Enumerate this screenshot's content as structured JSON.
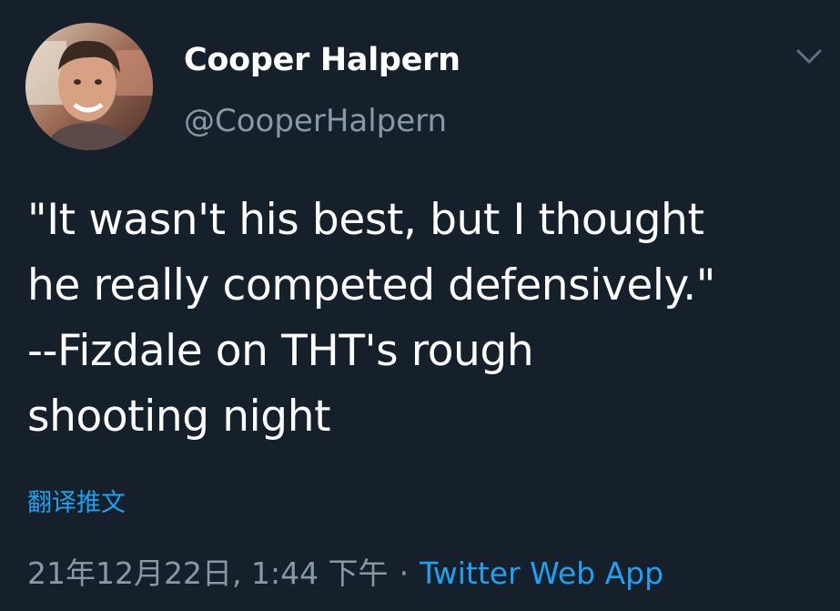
{
  "user": {
    "name": "Cooper Halpern",
    "handle": "@CooperHalpern"
  },
  "tweet": {
    "text": "\"It wasn't his best, but I thought\nhe really competed defensively.\"\n--Fizdale on THT's rough\nshooting night",
    "translate_label": "翻译推文",
    "timestamp": "21年12月22日, 1:44 下午",
    "separator": "·",
    "source": "Twitter Web App"
  },
  "icons": {
    "menu": "chevron-down-icon",
    "avatar": "profile-photo"
  },
  "colors": {
    "background": "#15202b",
    "primary_text": "#ffffff",
    "secondary_text": "#8899a6",
    "accent": "#1da1f2"
  }
}
